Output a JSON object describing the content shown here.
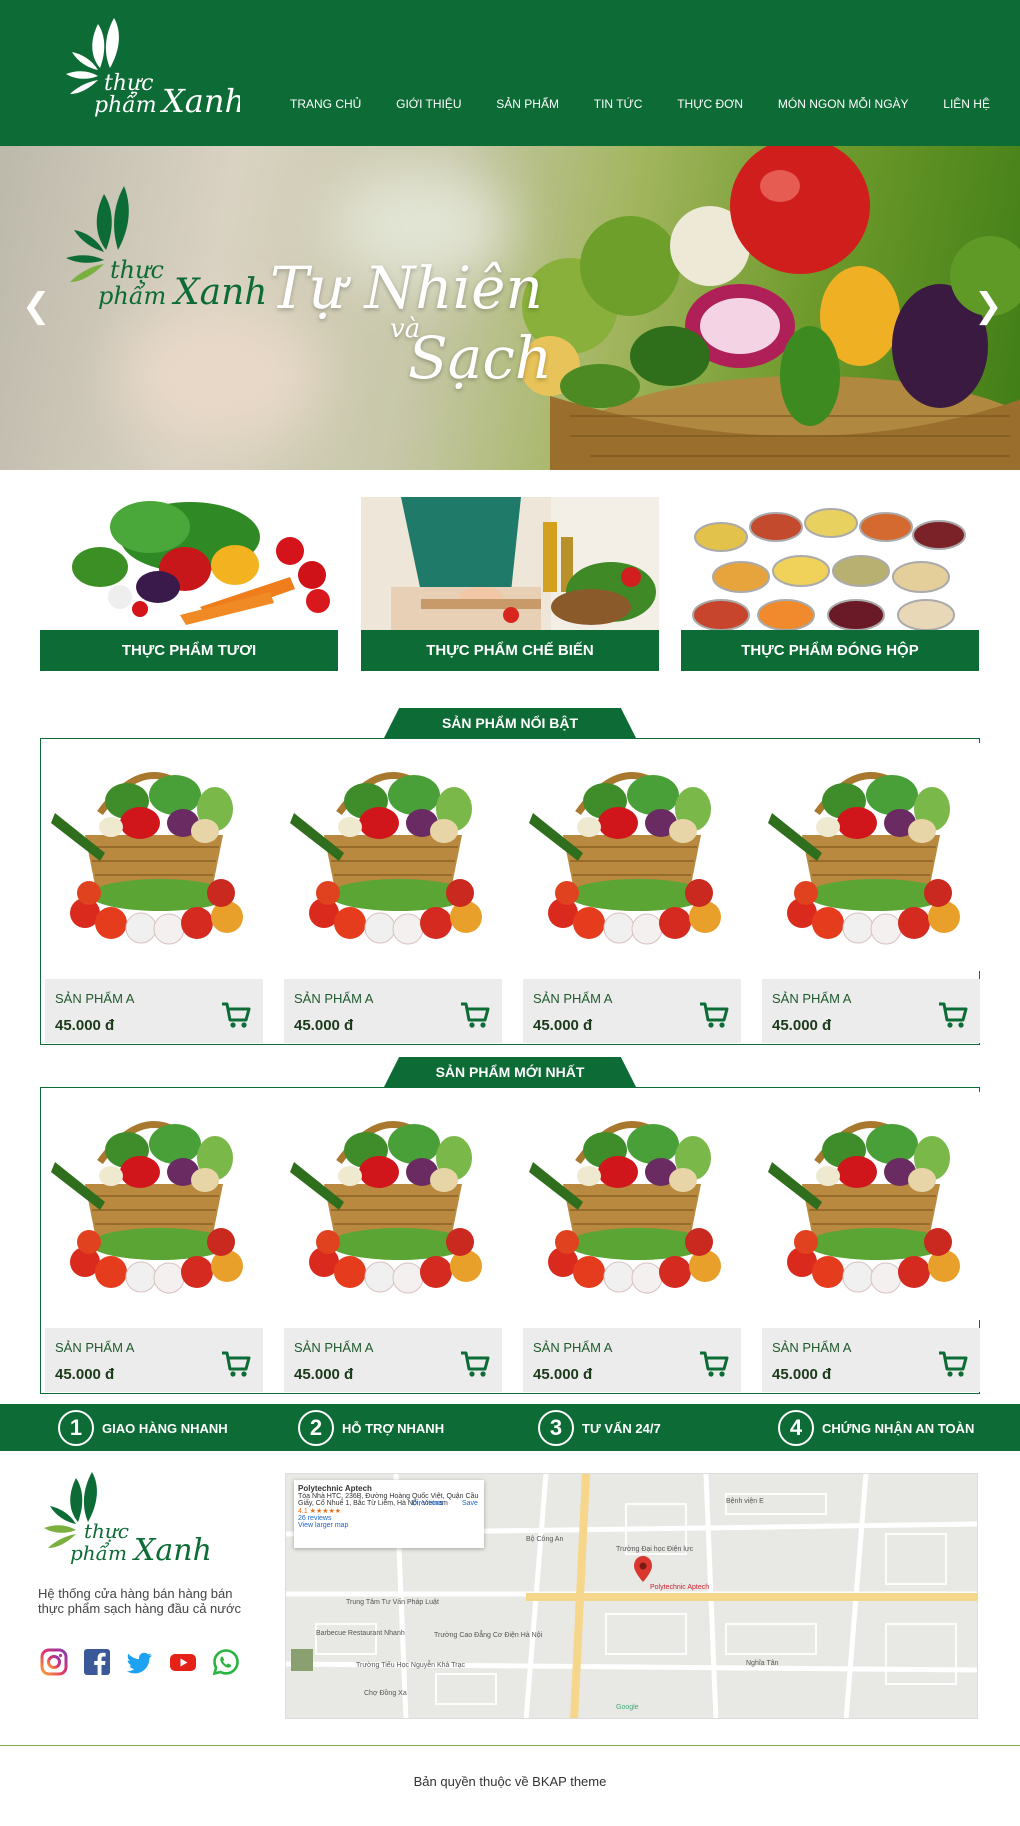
{
  "brand": {
    "logo_text_1": "thực",
    "logo_text_2": "phẩm",
    "logo_text_3": "Xanh",
    "color_primary": "#0d6b35",
    "color_accent": "#7bb040"
  },
  "nav": {
    "items": [
      {
        "label": "TRANG CHỦ"
      },
      {
        "label": "GIỚI THIỆU"
      },
      {
        "label": "SẢN PHẨM"
      },
      {
        "label": "TIN TỨC"
      },
      {
        "label": "THỰC ĐƠN"
      },
      {
        "label": "MÓN NGON MỖI NGÀY"
      },
      {
        "label": "LIÊN HỆ"
      }
    ]
  },
  "banner": {
    "tagline_1": "Tự Nhiên",
    "tagline_2": "và",
    "tagline_3": "Sạch",
    "prev_icon": "chevron-left-icon",
    "next_icon": "chevron-right-icon",
    "prev_glyph": "❮",
    "next_glyph": "❯"
  },
  "categories": [
    {
      "label": "THỰC PHẨM TƯƠI"
    },
    {
      "label": "THỰC PHẨM CHẾ BIẾN"
    },
    {
      "label": "THỰC PHẨM ĐÓNG HỘP"
    }
  ],
  "featured": {
    "title": "SẢN PHẨM NỔI BẬT",
    "products": [
      {
        "name": "SẢN PHẨM A",
        "price": "45.000 đ"
      },
      {
        "name": "SẢN PHẨM A",
        "price": "45.000 đ"
      },
      {
        "name": "SẢN PHẨM A",
        "price": "45.000 đ"
      },
      {
        "name": "SẢN PHẨM A",
        "price": "45.000 đ"
      }
    ]
  },
  "newest": {
    "title": "SẢN PHẨM MỚI NHẤT",
    "products": [
      {
        "name": "SẢN PHẨM A",
        "price": "45.000 đ"
      },
      {
        "name": "SẢN PHẨM A",
        "price": "45.000 đ"
      },
      {
        "name": "SẢN PHẨM A",
        "price": "45.000 đ"
      },
      {
        "name": "SẢN PHẨM A",
        "price": "45.000 đ"
      }
    ]
  },
  "features": [
    {
      "num": "1",
      "label": "GIAO HÀNG NHANH"
    },
    {
      "num": "2",
      "label": "HỖ TRỢ NHANH"
    },
    {
      "num": "3",
      "label": "TƯ VẤN 24/7"
    },
    {
      "num": "4",
      "label": "CHỨNG NHẬN AN TOÀN"
    }
  ],
  "footer": {
    "description": "Hệ thống cửa hàng bán hàng bán thực phẩm sạch hàng đầu cả nước",
    "socials": [
      "instagram-icon",
      "facebook-icon",
      "twitter-icon",
      "youtube-icon",
      "whatsapp-icon"
    ],
    "copyright": "Bản quyền thuộc về BKAP theme"
  },
  "map": {
    "place_title": "Polytechnic Aptech",
    "place_address": "Tòa Nhà HTC, 236B, Đường Hoàng Quốc Việt, Quận Cầu Giấy, Cổ Nhuế 1, Bắc Từ Liêm, Hà Nội, Vietnam",
    "rating": "4.1 ★★★★★",
    "reviews": "26 reviews",
    "view_larger": "View larger map",
    "directions": "Directions",
    "save": "Save",
    "marker_label": "Polytechnic Aptech",
    "labels": [
      "Bệnh viện E",
      "Bộ Công An",
      "Trường Đại học Điện lực",
      "Trung Tâm Tư Vấn Pháp Luật",
      "Barbecue Restaurant Nhanh",
      "Trường Cao Đẳng Cơ Điện Hà Nội",
      "Trường Tiểu Học Nguyễn Khả Trạc",
      "Chợ Đồng Xa",
      "Nghĩa Tân",
      "Google"
    ]
  }
}
